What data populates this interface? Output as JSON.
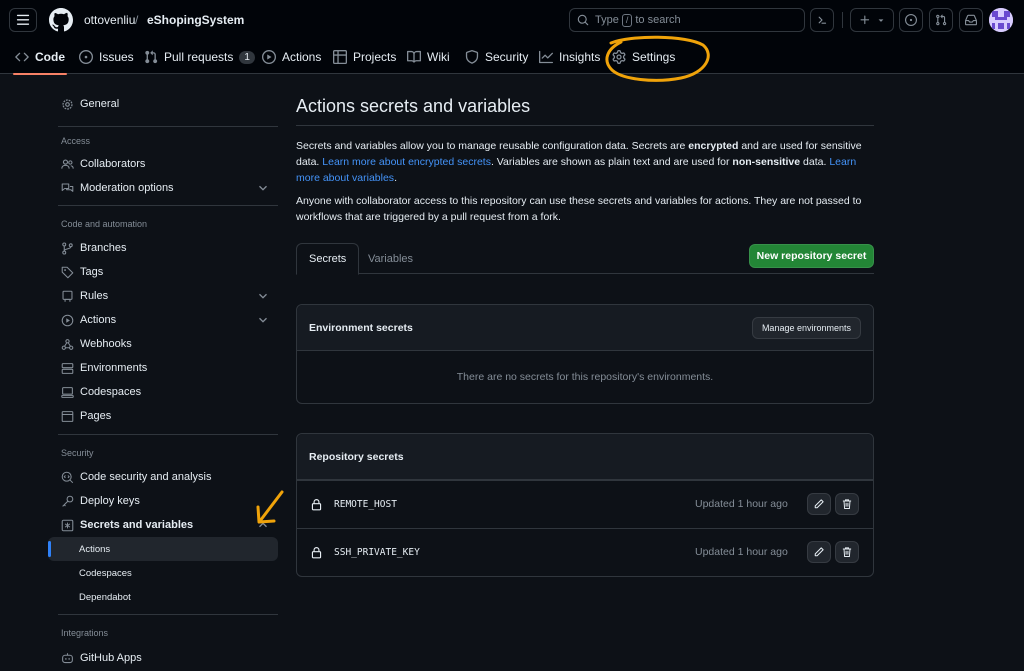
{
  "header": {
    "owner": "ottovenliu",
    "separator": "/",
    "repo": "eShopingSystem",
    "search": {
      "prefix": "Type",
      "key": "/",
      "suffix": "to search"
    }
  },
  "repo_tabs": [
    {
      "label": "Code",
      "icon": "code-icon",
      "active": true
    },
    {
      "label": "Issues",
      "icon": "issue-icon"
    },
    {
      "label": "Pull requests",
      "icon": "pull-request-icon",
      "count": "1"
    },
    {
      "label": "Actions",
      "icon": "play-icon"
    },
    {
      "label": "Projects",
      "icon": "table-icon"
    },
    {
      "label": "Wiki",
      "icon": "book-icon"
    },
    {
      "label": "Security",
      "icon": "shield-icon"
    },
    {
      "label": "Insights",
      "icon": "graph-icon"
    },
    {
      "label": "Settings",
      "icon": "gear-icon"
    }
  ],
  "sidebar": {
    "general": "General",
    "access_heading": "Access",
    "collaborators": "Collaborators",
    "moderation": "Moderation options",
    "code_heading": "Code and automation",
    "branches": "Branches",
    "tags": "Tags",
    "rules": "Rules",
    "actions": "Actions",
    "webhooks": "Webhooks",
    "environments": "Environments",
    "codespaces": "Codespaces",
    "pages": "Pages",
    "security_heading": "Security",
    "code_security": "Code security and analysis",
    "deploy_keys": "Deploy keys",
    "secrets_vars": "Secrets and variables",
    "sub_actions": "Actions",
    "sub_codespaces": "Codespaces",
    "sub_dependabot": "Dependabot",
    "integrations_heading": "Integrations",
    "github_apps": "GitHub Apps"
  },
  "main": {
    "title": "Actions secrets and variables",
    "p1": {
      "a": "Secrets and variables allow you to manage reusable configuration data. Secrets are ",
      "b": "encrypted",
      "c": " and are used for sensitive data. ",
      "link1": "Learn more about encrypted secrets",
      "d": ". Variables are shown as plain text and are used for ",
      "e": "non-sensitive",
      "f": " data. ",
      "link2": "Learn more about variables",
      "g": "."
    },
    "p2": "Anyone with collaborator access to this repository can use these secrets and variables for actions. They are not passed to workflows that are triggered by a pull request from a fork.",
    "tab_secrets": "Secrets",
    "tab_variables": "Variables",
    "new_secret_button": "New repository secret",
    "env_title": "Environment secrets",
    "manage_env_button": "Manage environments",
    "env_empty": "There are no secrets for this repository's environments.",
    "repo_title": "Repository secrets",
    "secrets": [
      {
        "name": "REMOTE_HOST",
        "updated": "Updated 1 hour ago"
      },
      {
        "name": "SSH_PRIVATE_KEY",
        "updated": "Updated 1 hour ago"
      }
    ]
  },
  "colors": {
    "background": "#0d1117",
    "accent_green": "#238636",
    "link_blue": "#4493f8",
    "annotation": "#f0a30a"
  }
}
